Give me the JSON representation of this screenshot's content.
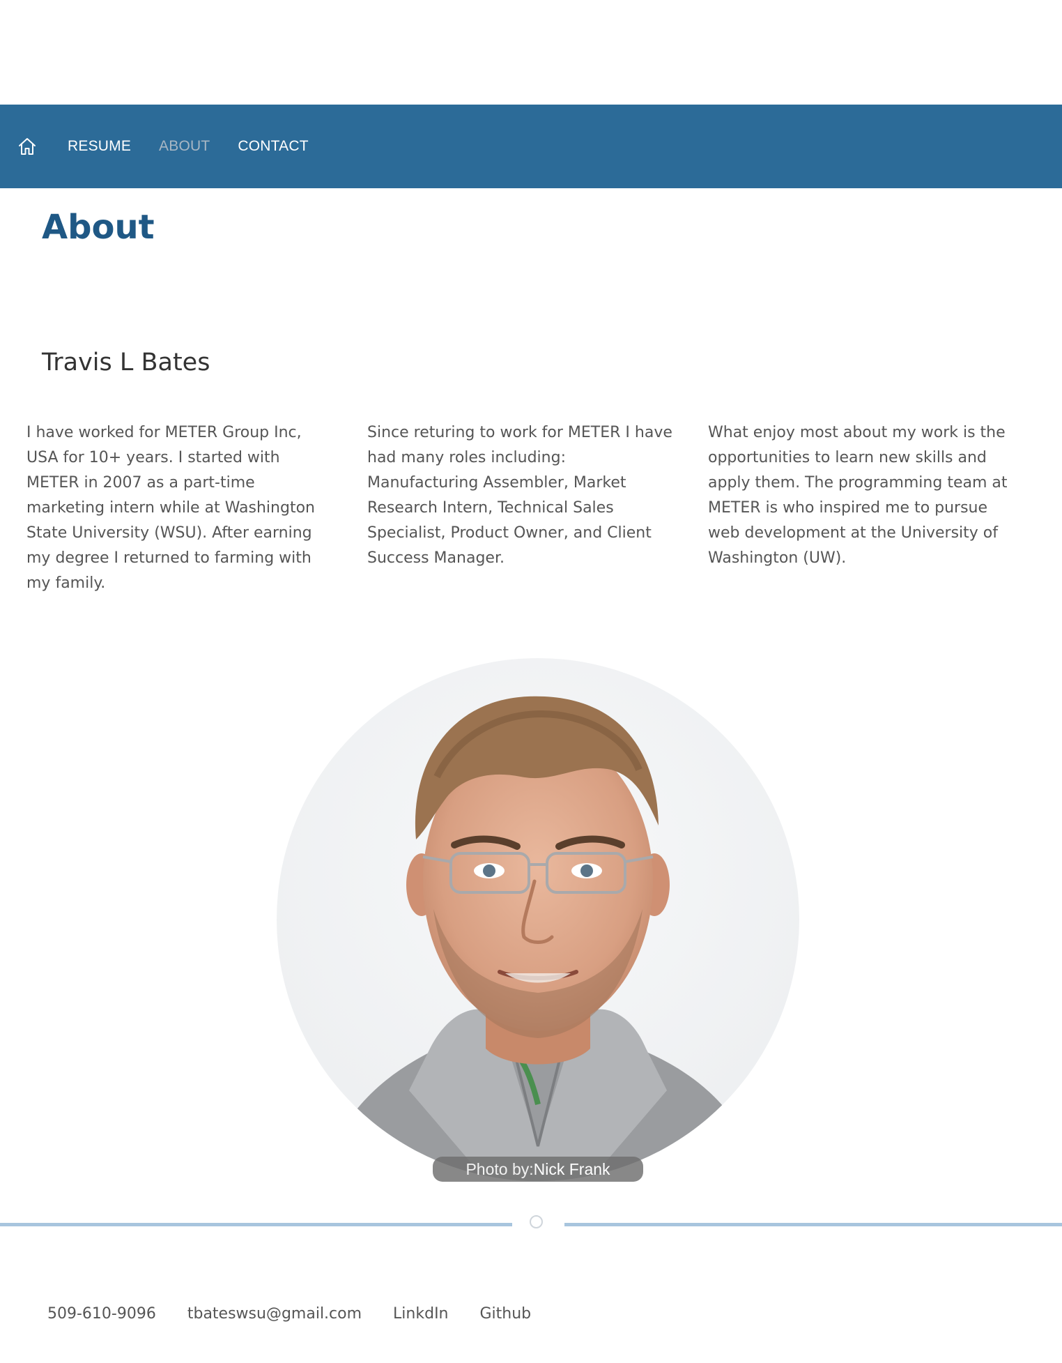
{
  "nav": {
    "home_icon": "home-icon",
    "items": [
      {
        "label": "RESUME",
        "active": false
      },
      {
        "label": "ABOUT",
        "active": true
      },
      {
        "label": "CONTACT",
        "active": false
      }
    ],
    "bg_color": "#2c6b98",
    "active_color": "#a8b7c4"
  },
  "page": {
    "title": "About",
    "title_color": "#1f5885"
  },
  "person": {
    "name": "Travis L Bates"
  },
  "bio": [
    "I have worked for METER Group Inc, USA for 10+ years. I started with METER in 2007 as a part-time marketing intern while at Washington State University (WSU). After earning my degree I returned to farming with my family.",
    "Since returing to work for METER I have had many roles including: Manufacturing Assembler, Market Research Intern, Technical Sales Specialist, Product Owner, and Client Success Manager.",
    "What enjoy most about my work is the opportunities to learn new skills and apply them. The programming team at METER is who inspired me to pursue web development at the University of Washington (UW)."
  ],
  "photo": {
    "credit_prefix": "Photo by:",
    "credit_name": "Nick Frank"
  },
  "footer": {
    "phone": "509-610-9096",
    "email": "tbateswsu@gmail.com",
    "linkedin": "LinkdIn",
    "github": "Github"
  }
}
